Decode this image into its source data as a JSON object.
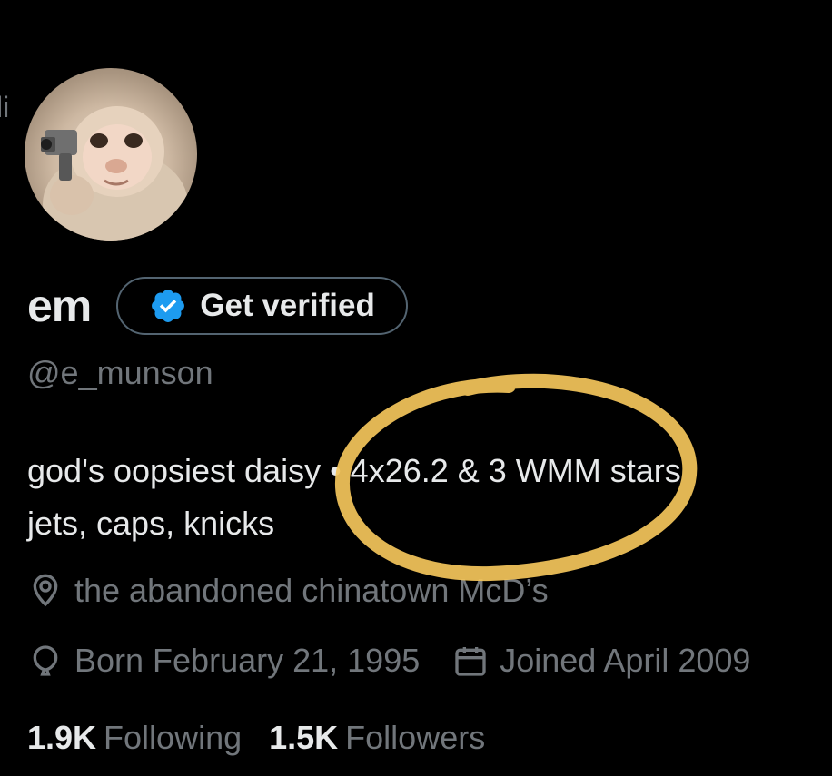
{
  "edge_fragment": "li",
  "profile": {
    "display_name": "em",
    "verify_button_label": "Get verified",
    "handle": "@e_munson",
    "bio_line1": "god's oopsiest daisy • 4x26.2 & 3 WMM stars",
    "bio_line2": "jets, caps, knicks",
    "location": "the abandoned chinatown McD’s",
    "birthday": "Born February 21, 1995",
    "joined": "Joined April 2009",
    "following_count": "1.9K",
    "following_label": "Following",
    "followers_count": "1.5K",
    "followers_label": "Followers"
  },
  "icons": {
    "verified": "verified-badge-icon",
    "location": "location-pin-icon",
    "birthday": "balloon-icon",
    "joined": "calendar-icon"
  },
  "colors": {
    "background": "#000000",
    "primary_text": "#e7e9ea",
    "secondary_text": "#71767b",
    "verified_blue": "#1d9bf0",
    "annotation_circle": "#f2c45a"
  }
}
